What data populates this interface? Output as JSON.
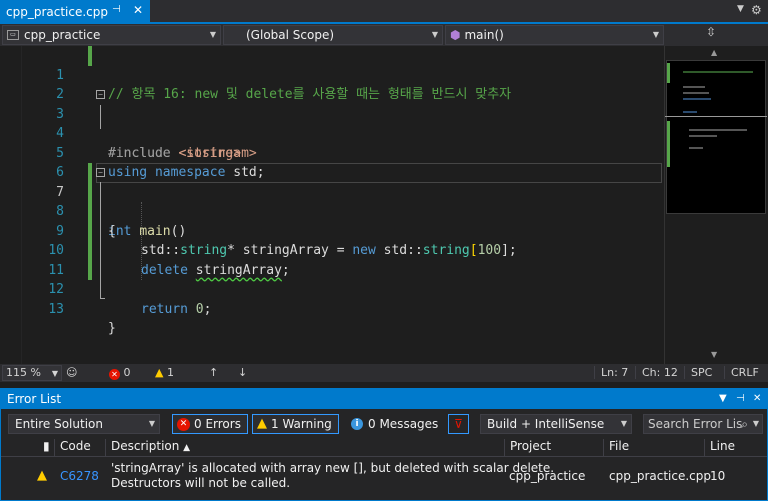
{
  "tab": {
    "filename": "cpp_practice.cpp",
    "pin_icon": "pin-icon",
    "close_icon": "close-icon"
  },
  "navbar": {
    "project": "cpp_practice",
    "scope": "(Global Scope)",
    "member": "main()"
  },
  "editor": {
    "lines": [
      {
        "num": "1",
        "html": "// 항목 16: new 및 delete를 사용할 때는 형태를 반드시 맞추자"
      },
      {
        "num": "2"
      },
      {
        "num": "3"
      },
      {
        "num": "4"
      },
      {
        "num": "5"
      },
      {
        "num": "6"
      },
      {
        "num": "7"
      },
      {
        "num": "8"
      },
      {
        "num": "9"
      },
      {
        "num": "10"
      },
      {
        "num": "11"
      },
      {
        "num": "12"
      },
      {
        "num": "13"
      }
    ],
    "tokens": {
      "l1": "// 항목 16: new 및 delete를 사용할 때는 형태를 반드시 맞추자",
      "l3_inc": "#include",
      "l3_hdr": "<string>",
      "l4_inc": "#include",
      "l4_hdr": "<iostream>",
      "l5_using": "using",
      "l5_ns": "namespace",
      "l5_std": "std;",
      "l7_int": "int",
      "l7_main": "main",
      "l7_paren": "()",
      "l8": "{",
      "l9_std1": "std::",
      "l9_type1": "string",
      "l9_star": "*",
      "l9_var": "stringArray",
      "l9_eq": "=",
      "l9_new": "new",
      "l9_std2": "std::",
      "l9_type2": "string",
      "l9_lb": "[",
      "l9_num": "100",
      "l9_rb": "];",
      "l10_del": "delete",
      "l10_var": "stringArray",
      "l10_semi": ";",
      "l12_ret": "return",
      "l12_num": "0",
      "l12_semi": ";",
      "l13": "}"
    }
  },
  "status": {
    "zoom": "115 %",
    "errors": "0",
    "warnings": "1",
    "ln": "Ln: 7",
    "ch": "Ch: 12",
    "spc": "SPC",
    "crlf": "CRLF"
  },
  "error_list": {
    "title": "Error List",
    "scope": "Entire Solution",
    "errors_btn": "0 Errors",
    "warnings_btn": "1 Warning",
    "messages_btn": "0 Messages",
    "build_filter": "Build + IntelliSense",
    "search_placeholder": "Search Error Lis",
    "columns": {
      "code": "Code",
      "description": "Description",
      "project": "Project",
      "file": "File",
      "line": "Line"
    },
    "rows": [
      {
        "code": "C6278",
        "desc1": "'stringArray' is allocated with array new [], but deleted with scalar delete.",
        "desc2": "Destructors will not be called.",
        "project": "cpp_practice",
        "file": "cpp_practice.cpp",
        "line": "10"
      }
    ]
  },
  "colors": {
    "accent": "#007acc",
    "comment": "#57a64a",
    "keyword": "#569cd6",
    "type": "#4ec9b0",
    "error": "#e51400",
    "warning": "#ffcc00"
  }
}
